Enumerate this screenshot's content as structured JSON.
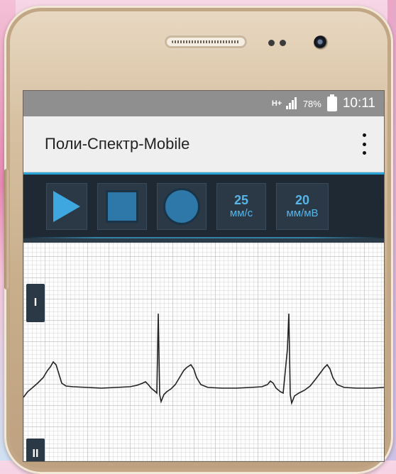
{
  "status_bar": {
    "network": "H+",
    "battery_percent": "78%",
    "time": "10:11",
    "signal_icon": "signal-icon",
    "battery_icon": "battery-icon"
  },
  "app_bar": {
    "title": "Поли-Спектр-Mobile",
    "menu_icon": "more-vert-icon"
  },
  "toolbar": {
    "play_icon": "play-icon",
    "stop_icon": "stop-icon",
    "record_icon": "record-icon",
    "speed": {
      "value": "25",
      "unit": "мм/с"
    },
    "gain": {
      "value": "20",
      "unit": "мм/мВ"
    },
    "accent_color": "#3fa7e0"
  },
  "ecg": {
    "leads": [
      "I",
      "II"
    ]
  }
}
